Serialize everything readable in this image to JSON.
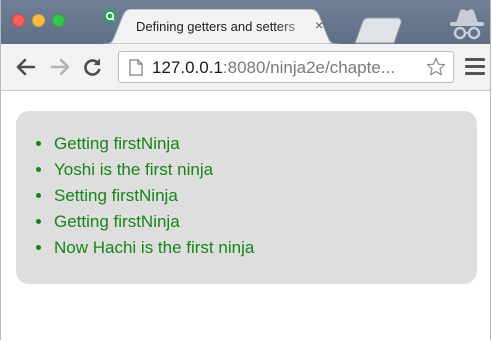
{
  "tab": {
    "title": "Defining getters and setters",
    "close_glyph": "×",
    "favicon": "refresh-circle-icon"
  },
  "toolbar": {
    "url_host": "127.0.0.1",
    "url_rest": ":8080/ninja2e/chapte...",
    "icons": [
      "back-arrow-icon",
      "forward-arrow-icon",
      "reload-icon",
      "page-icon",
      "star-icon",
      "menu-icon"
    ]
  },
  "page": {
    "items": [
      "Getting firstNinja",
      "Yoshi is the first ninja",
      "Setting firstNinja",
      "Getting firstNinja",
      "Now Hachi is the first ninja"
    ]
  },
  "colors": {
    "result_text": "#168516",
    "result_box": "#dedede",
    "tabstrip": "#6f7f95"
  }
}
